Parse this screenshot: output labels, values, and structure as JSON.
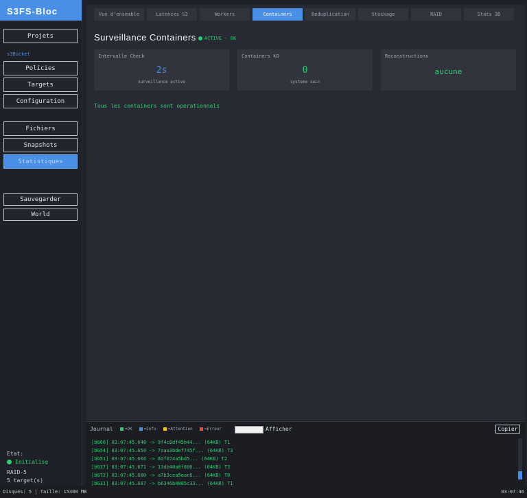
{
  "app": {
    "title": "S3FS-Bloc"
  },
  "sidebar": {
    "projets": "Projets",
    "bucket": "s3Bucket",
    "policies": "Policies",
    "targets": "Targets",
    "configuration": "Configuration",
    "fichiers": "Fichiers",
    "snapshots": "Snapshots",
    "statistiques": "Statistiques",
    "sauvegarder": "Sauvegarder",
    "world": "World",
    "status": {
      "label": "Etat:",
      "value": "Initialise",
      "raid": "RAID-5",
      "targets": "5 target(s)"
    }
  },
  "tabs": [
    {
      "label": "Vue d'ensemble"
    },
    {
      "label": "Latences S3"
    },
    {
      "label": "Workers"
    },
    {
      "label": "Containers",
      "active": true
    },
    {
      "label": "Deduplication"
    },
    {
      "label": "Stockage"
    },
    {
      "label": "RAID"
    },
    {
      "label": "Stats 3D"
    }
  ],
  "main": {
    "title": "Surveillance Containers",
    "badge": "ACTIVE - OK",
    "cards": [
      {
        "label": "Intervalle Check",
        "value": "2s",
        "sub": "surveillance active",
        "color": "#4a8fe6"
      },
      {
        "label": "Containers KO",
        "value": "0",
        "sub": "systeme sain",
        "color": "#2ecc71"
      },
      {
        "label": "Reconstructions",
        "value": "aucune",
        "sub": "",
        "color": "#2ecc71"
      }
    ],
    "message": "Tous les containers sont operationnels"
  },
  "journal": {
    "title": "Journal",
    "legend": [
      {
        "label": "=OK",
        "color": "#2ecc71"
      },
      {
        "label": "=Info",
        "color": "#4a8fe6"
      },
      {
        "label": "=Attention",
        "color": "#f1c40f"
      },
      {
        "label": "=Erreur",
        "color": "#e74c3c"
      }
    ],
    "afficher": "Afficher",
    "copy": "Copier",
    "lines": [
      "[bG66] 03:07:45.648 -> 9f4c8df45b44... (64KB) T1",
      "[bG54] 03:07:45.650 -> 7aaa3bdef745f... (64KB) T3",
      "[bG51] 03:07:45.666 -> 8df074a5bd5... (64KB) T2",
      "[bG37] 03:07:45.671 -> 13db40a0f606... (64KB) T3",
      "[bG72] 03:07:45.680 -> a7b3cea5eac6... (64KB) T0",
      "[bG31] 03:07:45.687 -> b6346b4805c33... (64KB) T1"
    ]
  },
  "footer": {
    "left": "Disques: 5 | Taille: 15300 MB",
    "right": "03:07:46"
  }
}
